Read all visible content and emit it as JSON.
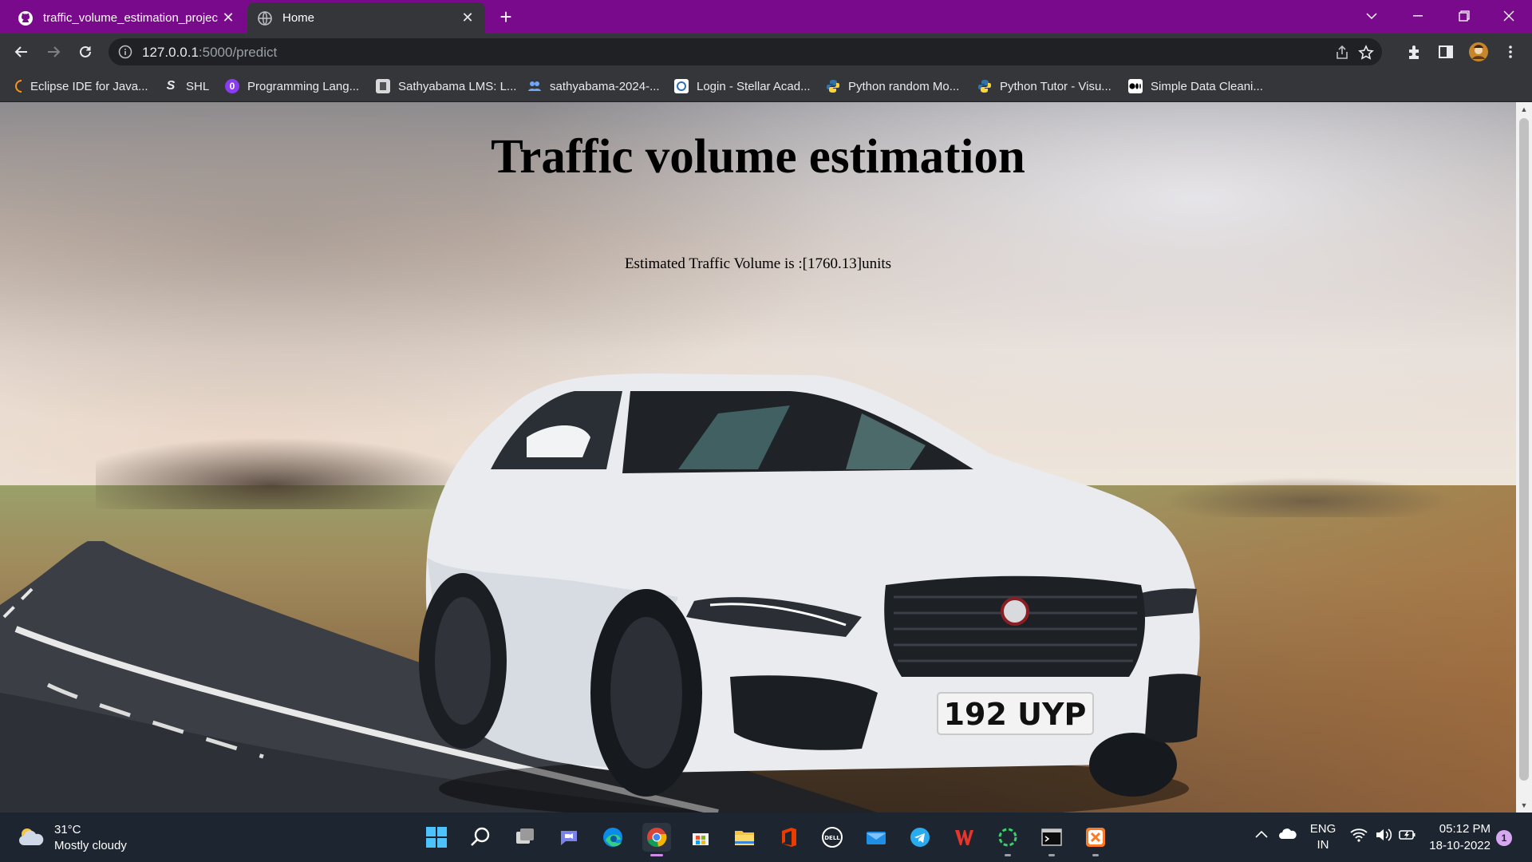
{
  "browser": {
    "tabs": [
      {
        "title": "traffic_volume_estimation_projec",
        "icon": "github-icon",
        "active": false
      },
      {
        "title": "Home",
        "icon": "globe-icon",
        "active": true
      }
    ],
    "address": {
      "host": "127.0.0.1",
      "rest": ":5000/predict"
    },
    "bookmarks": [
      {
        "label": "Eclipse IDE for Java...",
        "icon": "eclipse-icon"
      },
      {
        "label": "SHL",
        "icon": "shl-icon"
      },
      {
        "label": "Programming Lang...",
        "icon": "programming-icon"
      },
      {
        "label": "Sathyabama LMS: L...",
        "icon": "lms-icon"
      },
      {
        "label": "sathyabama-2024-...",
        "icon": "group-icon"
      },
      {
        "label": "Login - Stellar Acad...",
        "icon": "stellar-icon"
      },
      {
        "label": "Python random Mo...",
        "icon": "python-icon"
      },
      {
        "label": "Python Tutor - Visu...",
        "icon": "python-icon"
      },
      {
        "label": "Simple Data Cleani...",
        "icon": "medium-icon"
      }
    ]
  },
  "page": {
    "title": "Traffic volume estimation",
    "estimate": "Estimated Traffic Volume is :[1760.13]units",
    "plate_text": "192 UYP"
  },
  "taskbar": {
    "weather": {
      "temp": "31°C",
      "condition": "Mostly cloudy"
    },
    "apps": [
      "start-icon",
      "search-icon",
      "task-view-icon",
      "teams-chat-icon",
      "edge-icon",
      "chrome-icon",
      "store-icon",
      "file-explorer-icon",
      "office-icon",
      "dell-icon",
      "mail-icon",
      "telegram-icon",
      "wps-icon",
      "loading-app-icon",
      "terminal-icon",
      "xampp-icon"
    ],
    "language": {
      "line1": "ENG",
      "line2": "IN"
    },
    "time": "05:12 PM",
    "date": "18-10-2022",
    "notifications": "1"
  },
  "colors": {
    "tab_bar": "#7a0a8c",
    "toolbar": "#35363a",
    "taskbar": "#1c2530"
  }
}
